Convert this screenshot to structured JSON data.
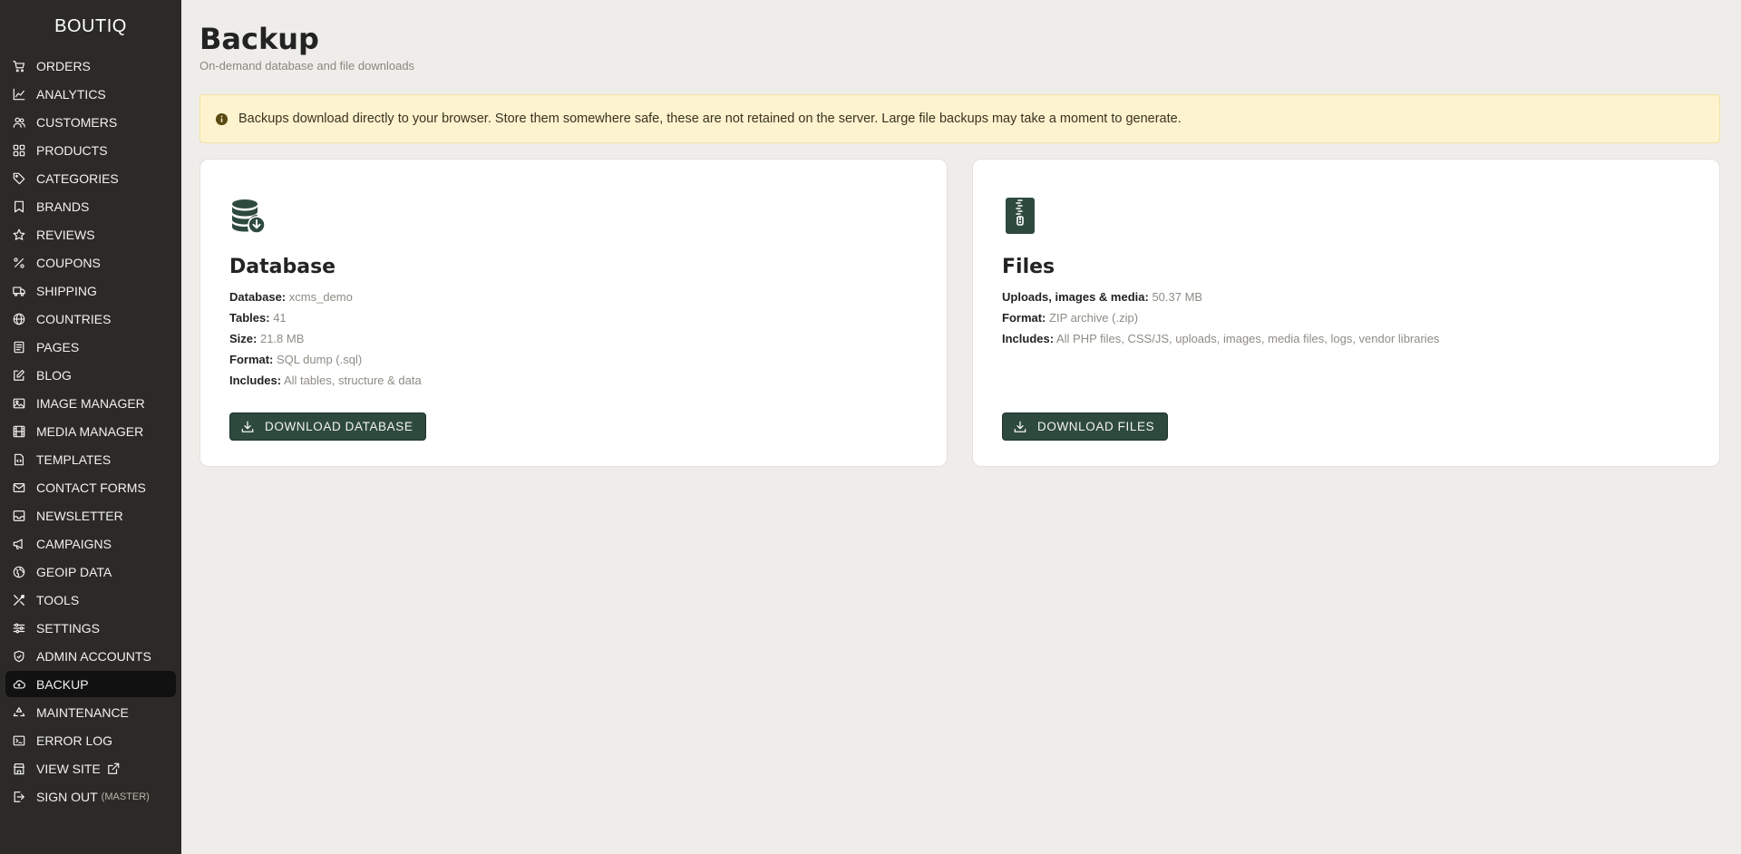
{
  "brand": "BOUTIQ",
  "sidebar": {
    "items": [
      {
        "label": "ORDERS",
        "icon": "cart-icon"
      },
      {
        "label": "ANALYTICS",
        "icon": "chart-line-icon"
      },
      {
        "label": "CUSTOMERS",
        "icon": "users-icon"
      },
      {
        "label": "PRODUCTS",
        "icon": "grid-icon"
      },
      {
        "label": "CATEGORIES",
        "icon": "tag-icon"
      },
      {
        "label": "BRANDS",
        "icon": "bookmark-icon"
      },
      {
        "label": "REVIEWS",
        "icon": "star-icon"
      },
      {
        "label": "COUPONS",
        "icon": "percent-icon"
      },
      {
        "label": "SHIPPING",
        "icon": "truck-icon"
      },
      {
        "label": "COUNTRIES",
        "icon": "globe-icon"
      },
      {
        "label": "PAGES",
        "icon": "page-icon"
      },
      {
        "label": "BLOG",
        "icon": "edit-icon"
      },
      {
        "label": "IMAGE MANAGER",
        "icon": "image-icon"
      },
      {
        "label": "MEDIA MANAGER",
        "icon": "film-icon"
      },
      {
        "label": "TEMPLATES",
        "icon": "file-code-icon"
      },
      {
        "label": "CONTACT FORMS",
        "icon": "mail-icon"
      },
      {
        "label": "NEWSLETTER",
        "icon": "inbox-icon"
      },
      {
        "label": "CAMPAIGNS",
        "icon": "megaphone-icon"
      },
      {
        "label": "GEOIP DATA",
        "icon": "globe-pin-icon"
      },
      {
        "label": "TOOLS",
        "icon": "tools-icon"
      },
      {
        "label": "SETTINGS",
        "icon": "sliders-icon"
      },
      {
        "label": "ADMIN ACCOUNTS",
        "icon": "shield-icon"
      },
      {
        "label": "BACKUP",
        "icon": "cloud-icon",
        "active": true
      },
      {
        "label": "MAINTENANCE",
        "icon": "recycle-icon"
      },
      {
        "label": "ERROR LOG",
        "icon": "terminal-icon"
      },
      {
        "label": "VIEW SITE",
        "icon": "store-icon"
      },
      {
        "label": "SIGN OUT",
        "icon": "logout-icon",
        "extra": "(MASTER)"
      }
    ]
  },
  "page": {
    "title": "Backup",
    "subtitle": "On-demand database and file downloads"
  },
  "notice": {
    "text": "Backups download directly to your browser. Store them somewhere safe, these are not retained on the server. Large file backups may take a moment to generate."
  },
  "database_card": {
    "title": "Database",
    "details": [
      {
        "label": "Database:",
        "value": "xcms_demo"
      },
      {
        "label": "Tables:",
        "value": "41"
      },
      {
        "label": "Size:",
        "value": "21.8 MB"
      },
      {
        "label": "Format:",
        "value": "SQL dump (.sql)"
      },
      {
        "label": "Includes:",
        "value": "All tables, structure & data"
      }
    ],
    "button_label": "DOWNLOAD DATABASE"
  },
  "files_card": {
    "title": "Files",
    "details": [
      {
        "label": "Uploads, images & media:",
        "value": "50.37 MB"
      },
      {
        "label": "Format:",
        "value": "ZIP archive (.zip)"
      },
      {
        "label": "Includes:",
        "value": "All PHP files, CSS/JS, uploads, images, media files, logs, vendor libraries"
      }
    ],
    "button_label": "DOWNLOAD FILES"
  },
  "colors": {
    "sidebar_bg": "#2b2a27",
    "active_bg": "#111111",
    "page_bg": "#efede9",
    "accent": "#2e4a3e",
    "notice_bg": "#fdf3cf"
  }
}
